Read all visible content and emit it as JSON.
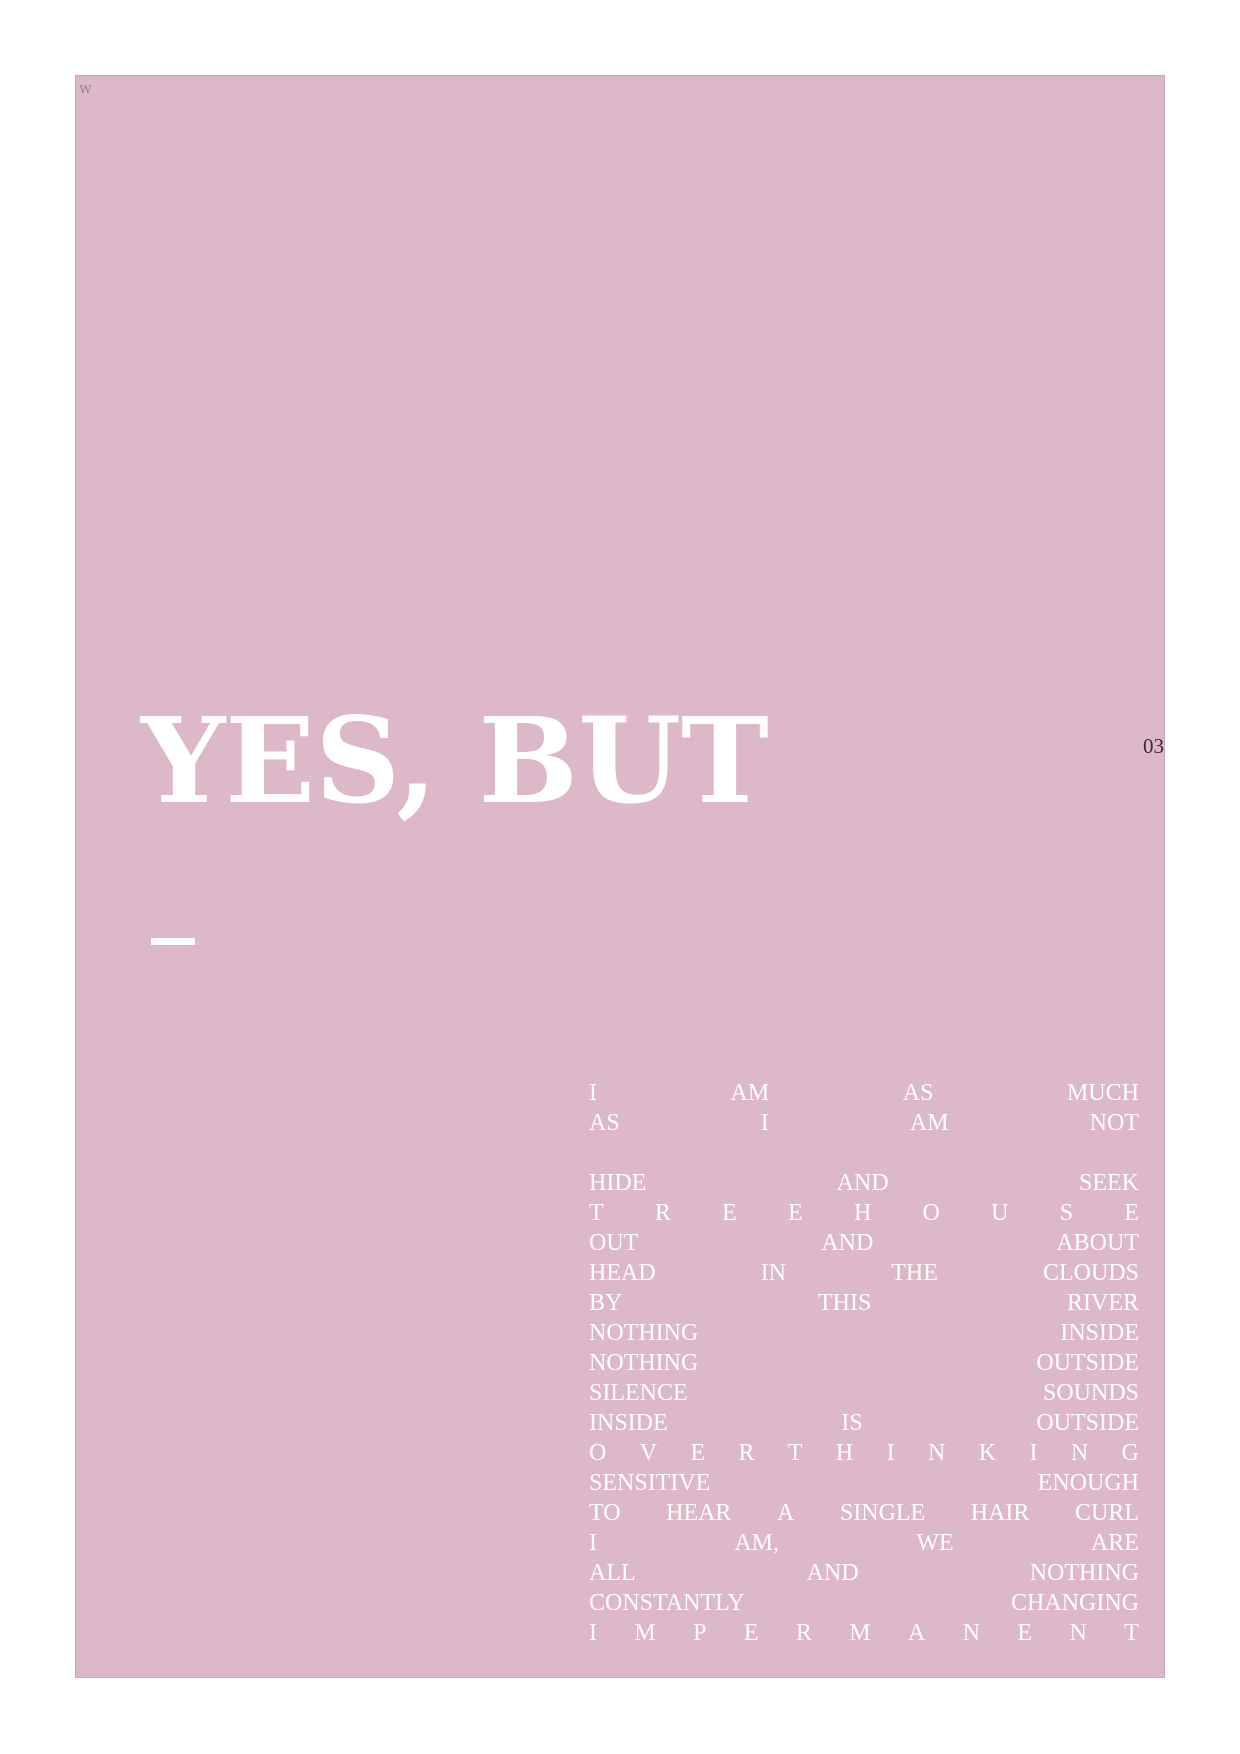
{
  "page": {
    "corner_mark": "w",
    "page_number": "03",
    "headline": "YES, BUT",
    "background_color": "#ddb8c8",
    "text_color": "#ffffff"
  },
  "poem": {
    "stanza1": [
      [
        "I",
        "AM",
        "AS",
        "MUCH"
      ],
      [
        "AS",
        "I",
        "AM",
        "NOT"
      ]
    ],
    "stanza2": [
      [
        "HIDE",
        "AND",
        "SEEK"
      ],
      [
        "T",
        "R",
        "E",
        "E",
        "H",
        "O",
        "U",
        "S",
        "E"
      ],
      [
        "OUT",
        "AND",
        "ABOUT"
      ],
      [
        "HEAD",
        "IN",
        "THE",
        "CLOUDS"
      ],
      [
        "BY",
        "THIS",
        "RIVER"
      ],
      [
        "NOTHING",
        "INSIDE"
      ],
      [
        "NOTHING",
        "OUTSIDE"
      ],
      [
        "SILENCE",
        "SOUNDS"
      ],
      [
        "INSIDE",
        "IS",
        "OUTSIDE"
      ],
      [
        "O",
        "V",
        "E",
        "R",
        "T",
        "H",
        "I",
        "N",
        "K",
        "I",
        "N",
        "G"
      ],
      [
        "SENSITIVE",
        "ENOUGH"
      ],
      [
        "TO",
        "HEAR",
        "A",
        "SINGLE",
        "HAIR",
        "CURL"
      ],
      [
        "I",
        "AM,",
        "WE",
        "ARE"
      ],
      [
        "ALL",
        "AND",
        "NOTHING"
      ],
      [
        "CONSTANTLY",
        "CHANGING"
      ],
      [
        "I",
        "M",
        "P",
        "E",
        "R",
        "M",
        "A",
        "N",
        "E",
        "N",
        "T"
      ]
    ]
  }
}
